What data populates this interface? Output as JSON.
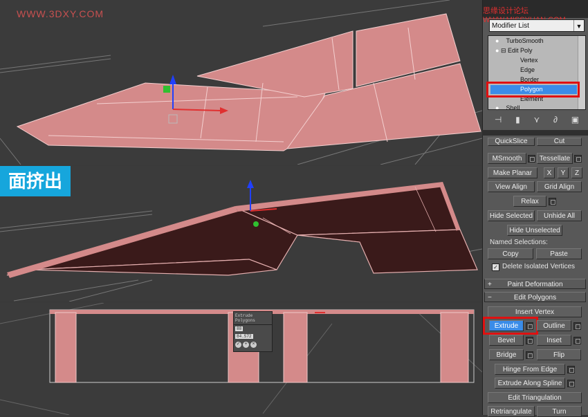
{
  "watermark_top": "WWW.3DXY.COM",
  "site_credit_a": "思缘设计论坛 ",
  "site_credit_b": "WWW.MISSYUAN.COM",
  "badge_text": "面挤出",
  "extrude_tooltip": {
    "title": "Extrude Polygons",
    "field1": "88",
    "field2": "84.572"
  },
  "modifier_list": {
    "label": "Modifier List",
    "arrow": "▼"
  },
  "stack_items": [
    {
      "label": "TurboSmooth"
    },
    {
      "label": "Edit Poly"
    },
    {
      "label": "Vertex"
    },
    {
      "label": "Edge"
    },
    {
      "label": "Border"
    },
    {
      "label": "Polygon"
    },
    {
      "label": "Element"
    },
    {
      "label": "Shell"
    }
  ],
  "toolbar_icons": [
    "pin-stack-icon",
    "show-end-result-icon",
    "make-unique-icon",
    "remove-modifier-icon",
    "configure-modifier-sets-icon"
  ],
  "panel": {
    "quickslice": "QuickSlice",
    "cut": "Cut",
    "msmooth": "MSmooth",
    "tessellate": "Tessellate",
    "make_planar": "Make Planar",
    "x": "X",
    "y": "Y",
    "z": "Z",
    "view_align": "View Align",
    "grid_align": "Grid Align",
    "relax": "Relax",
    "hide_selected": "Hide Selected",
    "unhide_all": "Unhide All",
    "hide_unselected": "Hide Unselected",
    "named_selections": "Named Selections:",
    "copy": "Copy",
    "paste": "Paste",
    "delete_isolated": "Delete Isolated Vertices",
    "paint_deformation": "Paint Deformation",
    "edit_polygons": "Edit Polygons",
    "insert_vertex": "Insert Vertex",
    "extrude": "Extrude",
    "outline": "Outline",
    "bevel": "Bevel",
    "inset": "Inset",
    "bridge": "Bridge",
    "flip": "Flip",
    "hinge_from_edge": "Hinge From Edge",
    "extrude_along_spline": "Extrude Along Spline",
    "edit_triangulation": "Edit Triangulation",
    "retriangulate": "Retriangulate",
    "turn": "Turn"
  },
  "colors": {
    "selection_blue": "#3a8ce8",
    "highlight_red": "#e01010",
    "mesh_pink": "#d48a8a",
    "mesh_dark": "#3a1a1a",
    "badge_blue": "#16a6dc"
  }
}
